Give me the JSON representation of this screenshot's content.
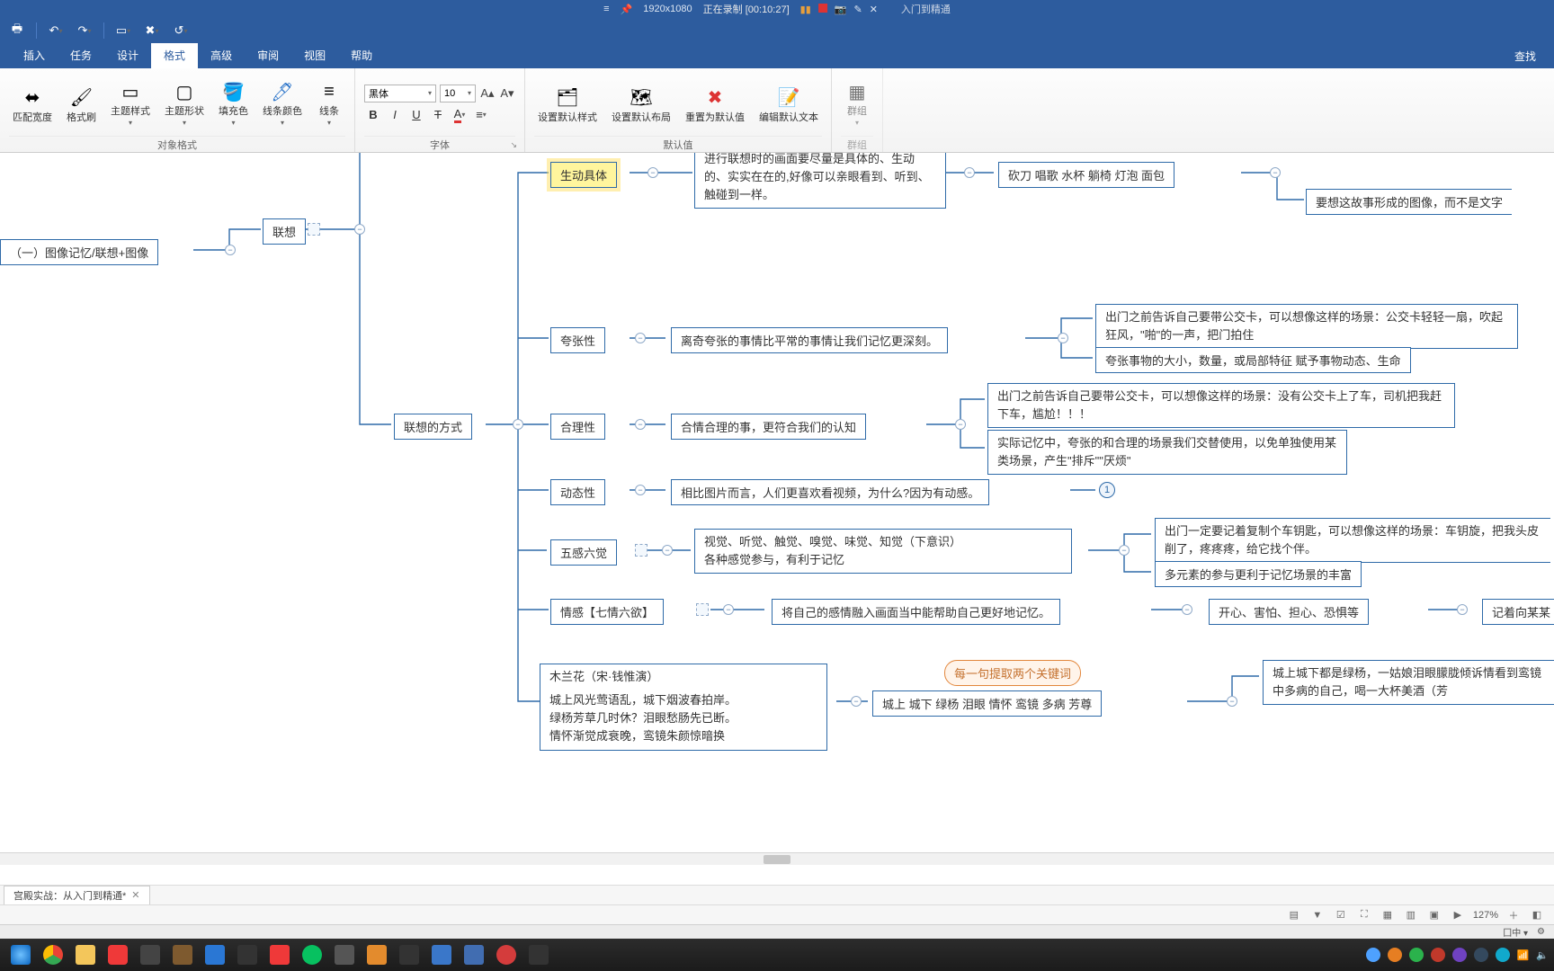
{
  "titlebar": {
    "resolution": "1920x1080",
    "recording": "正在录制 [00:10:27]",
    "app_suffix": "入门到精通"
  },
  "tabs": {
    "items": [
      "插入",
      "任务",
      "设计",
      "格式",
      "高级",
      "审阅",
      "视图",
      "帮助"
    ],
    "active_index": 3,
    "find": "查找"
  },
  "ribbon": {
    "group1": {
      "label": "对象格式",
      "btns": [
        "匹配宽度",
        "格式刷",
        "主题样式",
        "主题形状",
        "填充色",
        "线条颜色",
        "线条"
      ]
    },
    "group2": {
      "label": "字体",
      "font_name": "黑体",
      "font_size": "10"
    },
    "group3": {
      "label": "默认值",
      "btns": [
        "设置默认样式",
        "设置默认布局",
        "重置为默认值",
        "编辑默认文本"
      ]
    },
    "group4": {
      "label": "群组",
      "btn": "群组"
    }
  },
  "nodes": {
    "root": "（一）图像记忆/联想+图像",
    "lx": "联想",
    "method": "联想的方式",
    "n1": "生动具体",
    "n1_d": "进行联想时的画面要尽量是具体的、生动的、实实在在的,好像可以亲眼看到、听到、触碰到一样。",
    "n1_d2": "砍刀 唱歌 水杯 躺椅 灯泡 面包",
    "n1_d3": "要想这故事形成的图像，而不是文字",
    "n2": "夸张性",
    "n2_d": "离奇夸张的事情比平常的事情让我们记忆更深刻。",
    "n2_d2": "出门之前告诉自己要带公交卡，可以想像这样的场景：公交卡轻轻一扇，吹起狂风，\"啪\"的一声，把门拍住",
    "n2_d3": "夸张事物的大小，数量，或局部特征  赋予事物动态、生命",
    "n3": "合理性",
    "n3_d": "合情合理的事，更符合我们的认知",
    "n3_d2": "出门之前告诉自己要带公交卡，可以想像这样的场景：没有公交卡上了车，司机把我赶下车，尴尬！！！",
    "n3_d3": "实际记忆中，夸张的和合理的场景我们交替使用，以免单独使用某类场景，产生\"排斥\"\"厌烦\"",
    "n4": "动态性",
    "n4_d": "相比图片而言，人们更喜欢看视频，为什么?因为有动感。",
    "n4_num": "1",
    "n5": "五感六觉",
    "n5_d": "视觉、听觉、触觉、嗅觉、味觉、知觉（下意识）\n各种感觉参与，有利于记忆",
    "n5_d2": "出门一定要记着复制个车钥匙，可以想像这样的场景：车钥旋，把我头皮削了，疼疼疼，给它找个伴。",
    "n5_d3": "多元素的参与更利于记忆场景的丰富",
    "n6": "情感【七情六欲】",
    "n6_d": "将自己的感情融入画面当中能帮助自己更好地记忆。",
    "n6_d2": "开心、害怕、担心、恐惧等",
    "n6_d3": "记着向某某",
    "n7_title": "木兰花（宋·钱惟演）",
    "n7_l1": "城上风光莺语乱，城下烟波春拍岸。",
    "n7_l2": "绿杨芳草几时休？泪眼愁肠先已断。",
    "n7_l3": "情怀渐觉成衰晚，鸾镜朱颜惊暗换",
    "n7_kw": "城上  城下  绿杨  泪眼  情怀  鸾镜  多病  芳尊",
    "n7_tag": "每一句提取两个关键词",
    "n7_d2": "城上城下都是绿杨，一姑娘泪眼朦胧倾诉情看到鸾镜中多病的自己，喝一大杯美酒（芳"
  },
  "filetab": {
    "name": "宫殿实战：从入门到精通*"
  },
  "status": {
    "zoom": "127%"
  },
  "ime": {
    "lang": "中"
  }
}
